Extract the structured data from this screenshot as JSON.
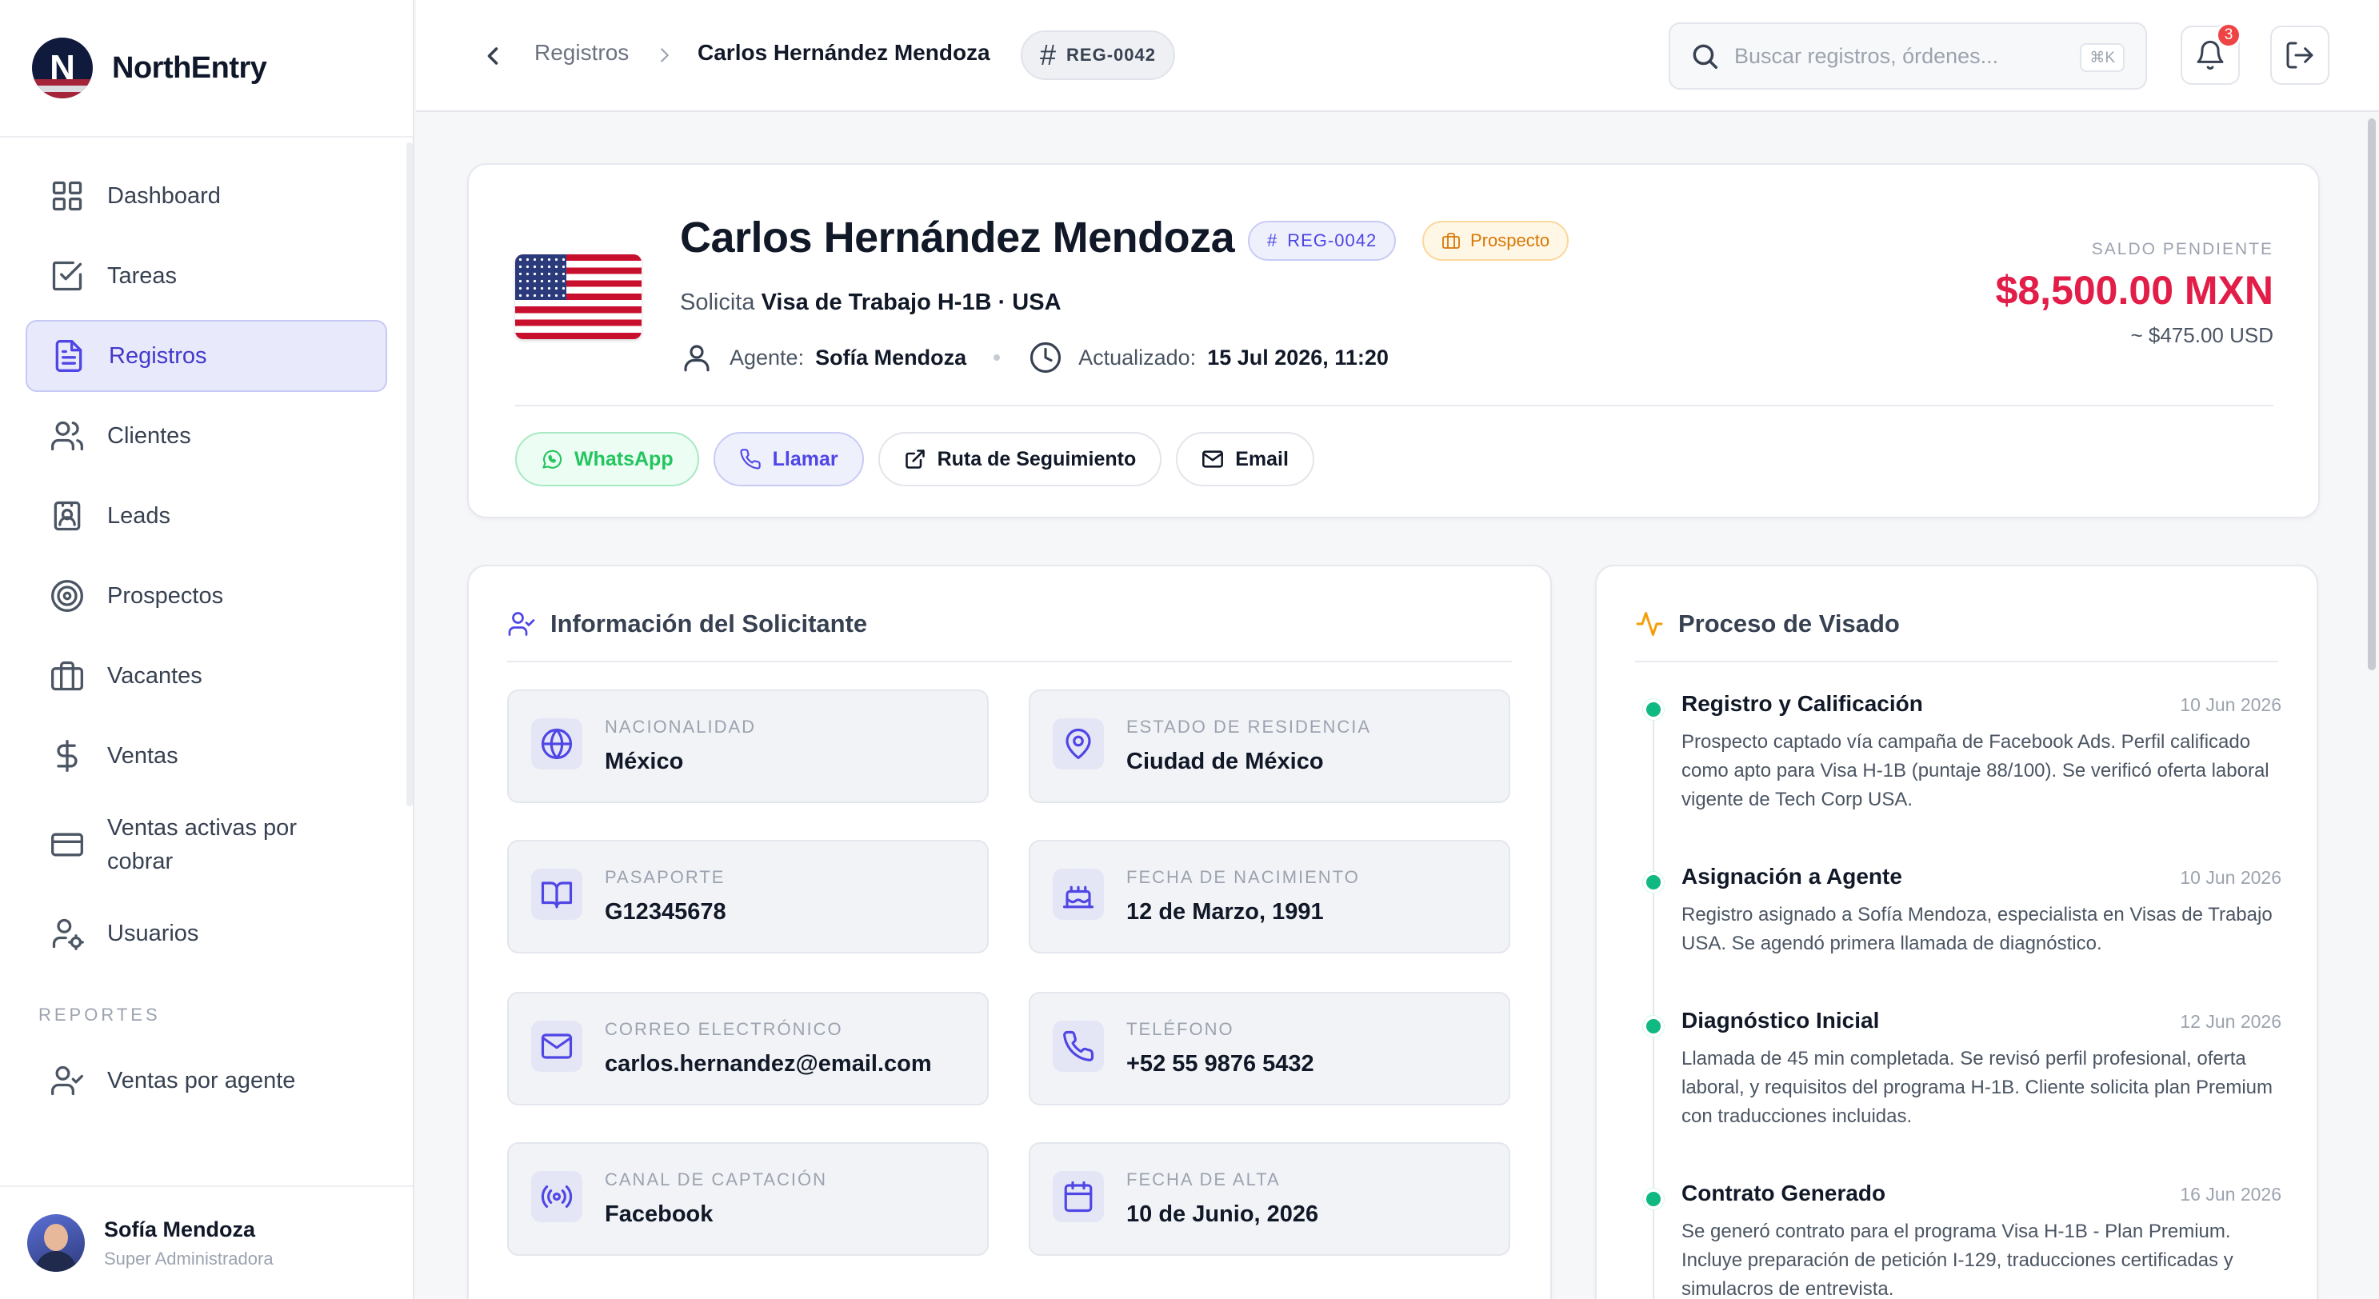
{
  "brand": {
    "name": "NorthEntry",
    "logo_letter": "N"
  },
  "sidebar": {
    "items": [
      {
        "label": "Dashboard",
        "icon": "grid-icon",
        "active": false
      },
      {
        "label": "Tareas",
        "icon": "checkbox-icon",
        "active": false
      },
      {
        "label": "Registros",
        "icon": "file-text-icon",
        "active": true
      },
      {
        "label": "Clientes",
        "icon": "users-icon",
        "active": false
      },
      {
        "label": "Leads",
        "icon": "contact-card-icon",
        "active": false
      },
      {
        "label": "Prospectos",
        "icon": "target-icon",
        "active": false
      },
      {
        "label": "Vacantes",
        "icon": "briefcase-icon",
        "active": false
      },
      {
        "label": "Ventas",
        "icon": "dollar-icon",
        "active": false
      },
      {
        "label": "Ventas activas por cobrar",
        "icon": "credit-card-icon",
        "active": false
      },
      {
        "label": "Usuarios",
        "icon": "user-gear-icon",
        "active": false
      }
    ],
    "section_reports": "REPORTES",
    "report_items": [
      {
        "label": "Ventas por agente",
        "icon": "user-check-icon"
      }
    ]
  },
  "user": {
    "name": "Sofía Mendoza",
    "role": "Super Administradora"
  },
  "topbar": {
    "breadcrumb_root": "Registros",
    "breadcrumb_current": "Carlos Hernández Mendoza",
    "record_id": "REG-0042",
    "search_placeholder": "Buscar registros, órdenes...",
    "search_shortcut": "⌘K",
    "notifications_count": "3"
  },
  "hero": {
    "name": "Carlos Hernández Mendoza",
    "record_id": "REG-0042",
    "status": "Prospecto",
    "request_prefix": "Solicita",
    "request_value": "Visa de Trabajo H-1B · USA",
    "agent_label": "Agente:",
    "agent_value": "Sofía Mendoza",
    "updated_label": "Actualizado:",
    "updated_value": "15 Jul 2026, 11:20",
    "balance_label": "SALDO PENDIENTE",
    "balance_value": "$8,500.00 MXN",
    "balance_usd": "~ $475.00 USD",
    "colors": {
      "balance": "#e11d48",
      "accent": "#4f46e5",
      "status": "#d97706",
      "whatsapp": "#22c55e"
    },
    "actions": {
      "whatsapp": "WhatsApp",
      "call": "Llamar",
      "tracking": "Ruta de Seguimiento",
      "email": "Email"
    }
  },
  "info": {
    "title": "Información del Solicitante",
    "fields": [
      {
        "label": "NACIONALIDAD",
        "value": "México",
        "icon": "globe-icon"
      },
      {
        "label": "ESTADO DE RESIDENCIA",
        "value": "Ciudad de México",
        "icon": "map-pin-icon"
      },
      {
        "label": "PASAPORTE",
        "value": "G12345678",
        "icon": "book-icon"
      },
      {
        "label": "FECHA DE NACIMIENTO",
        "value": "12 de Marzo, 1991",
        "icon": "cake-icon"
      },
      {
        "label": "CORREO ELECTRÓNICO",
        "value": "carlos.hernandez@email.com",
        "icon": "mail-icon"
      },
      {
        "label": "TELÉFONO",
        "value": "+52 55 9876 5432",
        "icon": "phone-icon"
      },
      {
        "label": "CANAL DE CAPTACIÓN",
        "value": "Facebook",
        "icon": "broadcast-icon"
      },
      {
        "label": "FECHA DE ALTA",
        "value": "10 de Junio, 2026",
        "icon": "calendar-icon"
      }
    ]
  },
  "process": {
    "title": "Proceso de Visado",
    "steps": [
      {
        "title": "Registro y Calificación",
        "date": "10 Jun 2026",
        "desc": "Prospecto captado vía campaña de Facebook Ads. Perfil calificado como apto para Visa H-1B (puntaje 88/100). Se verificó oferta laboral vigente de Tech Corp USA."
      },
      {
        "title": "Asignación a Agente",
        "date": "10 Jun 2026",
        "desc": "Registro asignado a Sofía Mendoza, especialista en Visas de Trabajo USA. Se agendó primera llamada de diagnóstico."
      },
      {
        "title": "Diagnóstico Inicial",
        "date": "12 Jun 2026",
        "desc": "Llamada de 45 min completada. Se revisó perfil profesional, oferta laboral, y requisitos del programa H-1B. Cliente solicita plan Premium con traducciones incluidas."
      },
      {
        "title": "Contrato Generado",
        "date": "16 Jun 2026",
        "desc": "Se generó contrato para el programa Visa H-1B - Plan Premium. Incluye preparación de petición I-129, traducciones certificadas y simulacros de entrevista."
      }
    ]
  }
}
